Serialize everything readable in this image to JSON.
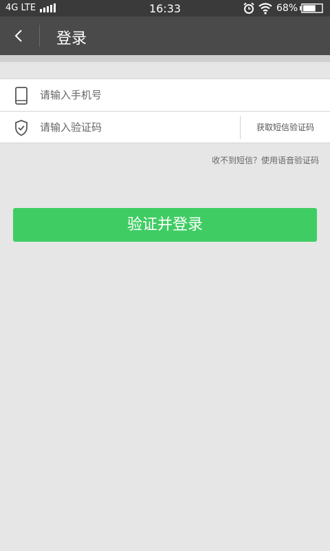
{
  "status_bar": {
    "carrier": "4G LTE",
    "time": "16:33",
    "battery_pct": "68%",
    "battery_level": 0.68,
    "icons": [
      "signal-icon",
      "alarm-icon",
      "wifi-icon",
      "battery-icon"
    ]
  },
  "title_bar": {
    "title": "登录",
    "back_icon": "chevron-left-icon"
  },
  "form": {
    "phone": {
      "icon": "phone-icon",
      "placeholder": "请输入手机号",
      "value": ""
    },
    "code": {
      "icon": "shield-icon",
      "placeholder": "请输入验证码",
      "value": "",
      "get_code_label": "获取短信验证码"
    }
  },
  "voice_code_link": "收不到短信？使用语音验证码",
  "login_button": "验证并登录",
  "colors": {
    "status_bar_bg": "#3a3a3a",
    "title_bar_bg": "#4a4a4a",
    "page_bg": "#e6e6e6",
    "primary_green": "#3fcd63"
  }
}
